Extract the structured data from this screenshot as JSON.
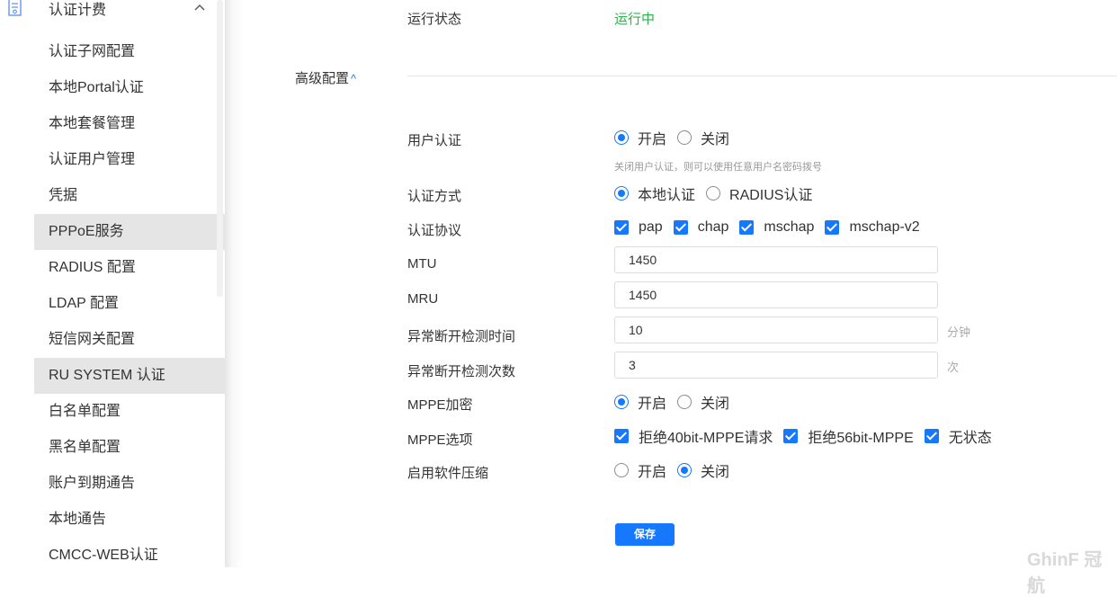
{
  "sidebar": {
    "group_title": "认证计费",
    "items": [
      {
        "label": "认证子网配置"
      },
      {
        "label": "本地Portal认证"
      },
      {
        "label": "本地套餐管理"
      },
      {
        "label": "认证用户管理"
      },
      {
        "label": "凭据"
      },
      {
        "label": "PPPoE服务",
        "active": true
      },
      {
        "label": "RADIUS 配置"
      },
      {
        "label": "LDAP 配置"
      },
      {
        "label": "短信网关配置"
      },
      {
        "label": "RU SYSTEM 认证",
        "active": true
      },
      {
        "label": "白名单配置"
      },
      {
        "label": "黑名单配置"
      },
      {
        "label": "账户到期通告"
      },
      {
        "label": "本地通告"
      },
      {
        "label": "CMCC-WEB认证"
      }
    ]
  },
  "main": {
    "run_status": {
      "label": "运行状态",
      "value": "运行中"
    },
    "advanced": {
      "title": "高级配置",
      "caret": "^"
    },
    "user_auth": {
      "label": "用户认证",
      "options": [
        "开启",
        "关闭"
      ],
      "selected": "开启",
      "hint": "关闭用户认证，则可以使用任意用户名密码拨号"
    },
    "auth_method": {
      "label": "认证方式",
      "options": [
        "本地认证",
        "RADIUS认证"
      ],
      "selected": "本地认证"
    },
    "auth_protocol": {
      "label": "认证协议",
      "options": [
        "pap",
        "chap",
        "mschap",
        "mschap-v2"
      ]
    },
    "mtu": {
      "label": "MTU",
      "value": "1450"
    },
    "mru": {
      "label": "MRU",
      "value": "1450"
    },
    "detect_time": {
      "label": "异常断开检测时间",
      "value": "10",
      "unit": "分钟"
    },
    "detect_count": {
      "label": "异常断开检测次数",
      "value": "3",
      "unit": "次"
    },
    "mppe_encrypt": {
      "label": "MPPE加密",
      "options": [
        "开启",
        "关闭"
      ],
      "selected": "开启"
    },
    "mppe_options": {
      "label": "MPPE选项",
      "options": [
        "拒绝40bit-MPPE请求",
        "拒绝56bit-MPPE",
        "无状态"
      ]
    },
    "compression": {
      "label": "启用软件压缩",
      "options": [
        "开启",
        "关闭"
      ],
      "selected": "关闭"
    },
    "save_label": "保存"
  },
  "watermark": "GhinF 冠航",
  "colors": {
    "accent": "#1677ff",
    "status_green": "#2ab24a",
    "active_bg": "#e5e5e5"
  }
}
